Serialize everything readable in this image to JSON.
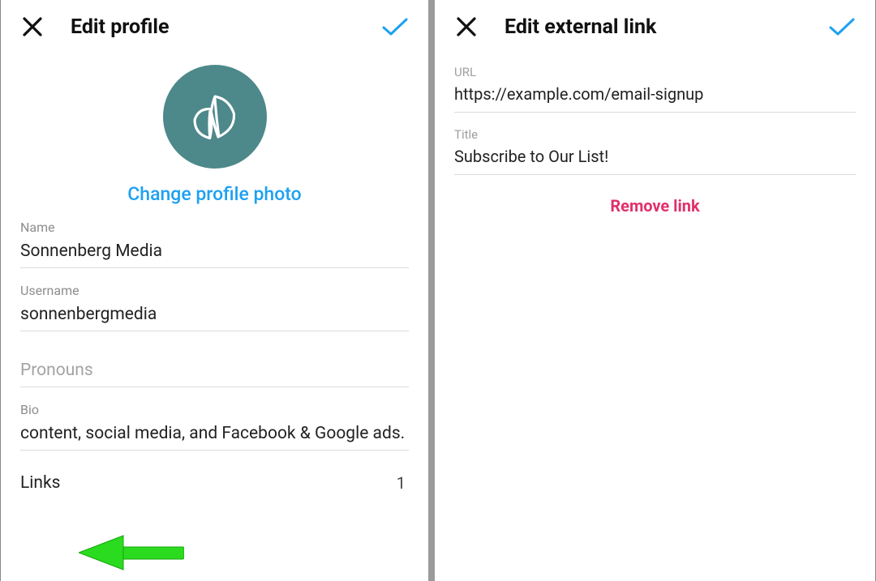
{
  "left": {
    "title": "Edit profile",
    "change_photo": "Change profile photo",
    "fields": {
      "name_label": "Name",
      "name_value": "Sonnenberg Media",
      "username_label": "Username",
      "username_value": "sonnenbergmedia",
      "pronouns_label": "Pronouns",
      "bio_label": "Bio",
      "bio_value": "content, social media, and Facebook & Google ads."
    },
    "links_label": "Links",
    "links_count": "1"
  },
  "right": {
    "title": "Edit external link",
    "url_label": "URL",
    "url_value": "https://example.com/email-signup",
    "title_label": "Title",
    "title_value": "Subscribe to Our List!",
    "remove_label": "Remove link"
  },
  "colors": {
    "accent_blue": "#1da1f2",
    "danger": "#e1306c",
    "avatar_bg": "#4d888a"
  }
}
